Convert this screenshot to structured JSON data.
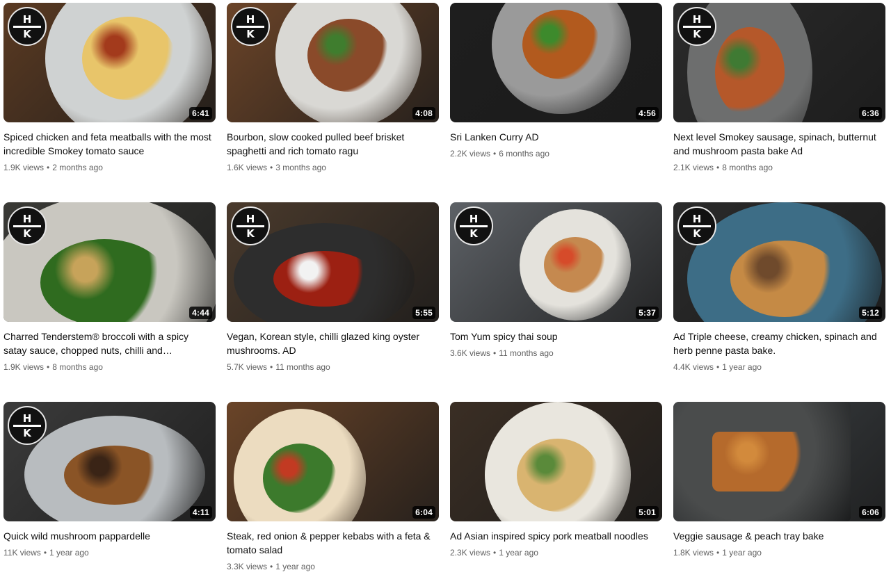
{
  "videos": [
    {
      "title": "Spiced chicken and feta meatballs with the most incredible Smokey tomato sauce",
      "duration": "6:41",
      "views": "1.9K views",
      "age": "2 months ago",
      "logo": true,
      "colors": {
        "bg": "#5a3a22",
        "plate": "#cfd2d2",
        "food": "#e8c56a",
        "accent": "#a33a1c"
      }
    },
    {
      "title": "Bourbon, slow cooked pulled beef brisket spaghetti and rich tomato ragu",
      "duration": "4:08",
      "views": "1.6K views",
      "age": "3 months ago",
      "logo": true,
      "colors": {
        "bg": "#6b4428",
        "plate": "#d9d8d4",
        "food": "#8a4a2a",
        "accent": "#3f7d2e"
      }
    },
    {
      "title": "Sri Lanken Curry AD",
      "duration": "4:56",
      "views": "2.2K views",
      "age": "6 months ago",
      "logo": false,
      "colors": {
        "bg": "#1e1e1e",
        "plate": "#9a9a9a",
        "food": "#b25a1e",
        "accent": "#3d8a2c"
      }
    },
    {
      "title": "Next level Smokey sausage, spinach, butternut and mushroom pasta bake Ad",
      "duration": "6:36",
      "views": "2.1K views",
      "age": "8 months ago",
      "logo": true,
      "colors": {
        "bg": "#2b2b2b",
        "plate": "#6d6e6e",
        "food": "#b5582a",
        "accent": "#3f7a33"
      }
    },
    {
      "title": "Charred Tenderstem® broccoli with a spicy satay sauce, chopped nuts, chilli and…",
      "duration": "4:44",
      "views": "1.9K views",
      "age": "8 months ago",
      "logo": true,
      "colors": {
        "bg": "#3a3a36",
        "plate": "#c9c7c0",
        "food": "#2f6b1f",
        "accent": "#c7a35a"
      }
    },
    {
      "title": "Vegan, Korean style, chilli glazed king oyster mushrooms. AD",
      "duration": "5:55",
      "views": "5.7K views",
      "age": "11 months ago",
      "logo": true,
      "colors": {
        "bg": "#4a3a2c",
        "plate": "#2d2d2d",
        "food": "#9c2012",
        "accent": "#f2f2f2"
      }
    },
    {
      "title": "Tom Yum spicy thai soup",
      "duration": "5:37",
      "views": "3.6K views",
      "age": "11 months ago",
      "logo": true,
      "colors": {
        "bg": "#5d6166",
        "plate": "#e4e2dc",
        "food": "#c5894f",
        "accent": "#d64b2a"
      }
    },
    {
      "title": "Ad Triple cheese, creamy chicken, spinach and herb penne pasta bake.",
      "duration": "5:12",
      "views": "4.4K views",
      "age": "1 year ago",
      "logo": true,
      "colors": {
        "bg": "#2a2a2a",
        "plate": "#3d6d86",
        "food": "#c58a45",
        "accent": "#6f4a2c"
      }
    },
    {
      "title": "Quick wild mushroom pappardelle",
      "duration": "4:11",
      "views": "11K views",
      "age": "1 year ago",
      "logo": true,
      "colors": {
        "bg": "#3b3b3b",
        "plate": "#b8bcbf",
        "food": "#8a5426",
        "accent": "#3a2416"
      }
    },
    {
      "title": "Steak, red onion & pepper kebabs with a feta & tomato salad",
      "duration": "6:04",
      "views": "3.3K views",
      "age": "1 year ago",
      "logo": false,
      "colors": {
        "bg": "#6a4428",
        "plate": "#ecdcc0",
        "food": "#3c7a2c",
        "accent": "#c23a22"
      }
    },
    {
      "title": "Ad Asian inspired spicy pork meatball noodles",
      "duration": "5:01",
      "views": "2.3K views",
      "age": "1 year ago",
      "logo": false,
      "colors": {
        "bg": "#3a2e24",
        "plate": "#e9e6de",
        "food": "#d9b470",
        "accent": "#5a8a3a"
      }
    },
    {
      "title": "Veggie sausage & peach tray bake",
      "duration": "6:06",
      "views": "1.8K views",
      "age": "1 year ago",
      "logo": false,
      "colors": {
        "bg": "#3f4448",
        "plate": "#4a4c4c",
        "food": "#b56a2c",
        "accent": "#d28a3c"
      }
    }
  ],
  "logo_text": {
    "top": "H",
    "bottom": "K"
  }
}
